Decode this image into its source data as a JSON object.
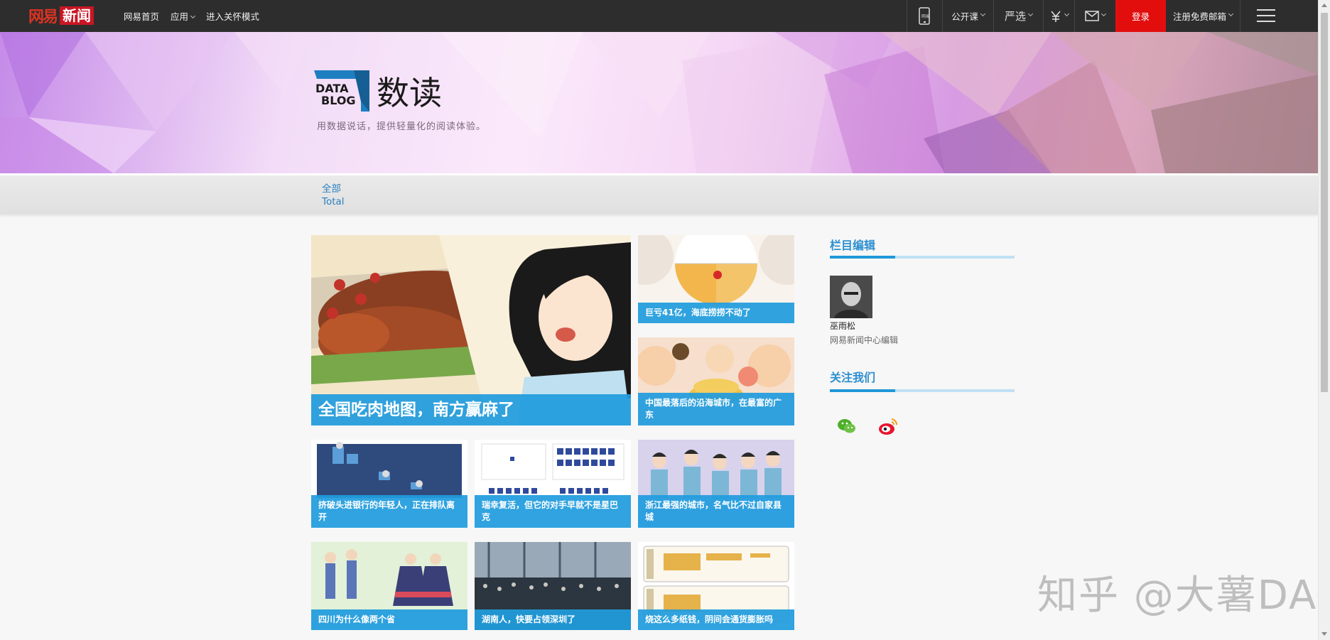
{
  "topbar": {
    "logo_text": "网易",
    "logo_badge": "新闻",
    "nav": {
      "home": "网易首页",
      "apps": "应用",
      "care_mode": "进入关怀模式"
    },
    "phone_label": "网易",
    "open_course": "公开课",
    "yanxuan": "严选",
    "login": "登录",
    "register_mail": "注册免费邮箱"
  },
  "banner": {
    "logo_line1": "DATA",
    "logo_line2": "BLOG",
    "title": "数读",
    "subtitle": "用数据说话，提供轻量化的阅读体验。"
  },
  "category": {
    "cn": "全部",
    "en": "Total"
  },
  "articles": [
    {
      "title": "全国吃肉地图，南方赢麻了"
    },
    {
      "title": "巨亏41亿，海底捞捞不动了"
    },
    {
      "title": "中国最落后的沿海城市，在最富的广东"
    },
    {
      "title": "挤破头进银行的年轻人，正在排队离开"
    },
    {
      "title": "瑞幸复活，但它的对手早就不是星巴克"
    },
    {
      "title": "浙江最强的城市，名气比不过自家县城"
    },
    {
      "title": "四川为什么像两个省"
    },
    {
      "title": "湖南人，快要占领深圳了"
    },
    {
      "title": "烧这么多纸钱，阴间会通货膨胀吗"
    }
  ],
  "sidebar": {
    "editor_heading": "栏目编辑",
    "editor_name": "巫雨松",
    "editor_role": "网易新闻中心编辑",
    "follow_heading": "关注我们"
  },
  "watermark": "知乎 @大薯DA",
  "colors": {
    "topbar": "#2d2d2d",
    "login": "#e20e0e",
    "caption": "#209cde",
    "accent": "#1f98d8"
  },
  "icons": [
    "phone-icon",
    "yuan-icon",
    "mail-icon",
    "menu-icon",
    "wechat-icon",
    "weibo-icon"
  ]
}
